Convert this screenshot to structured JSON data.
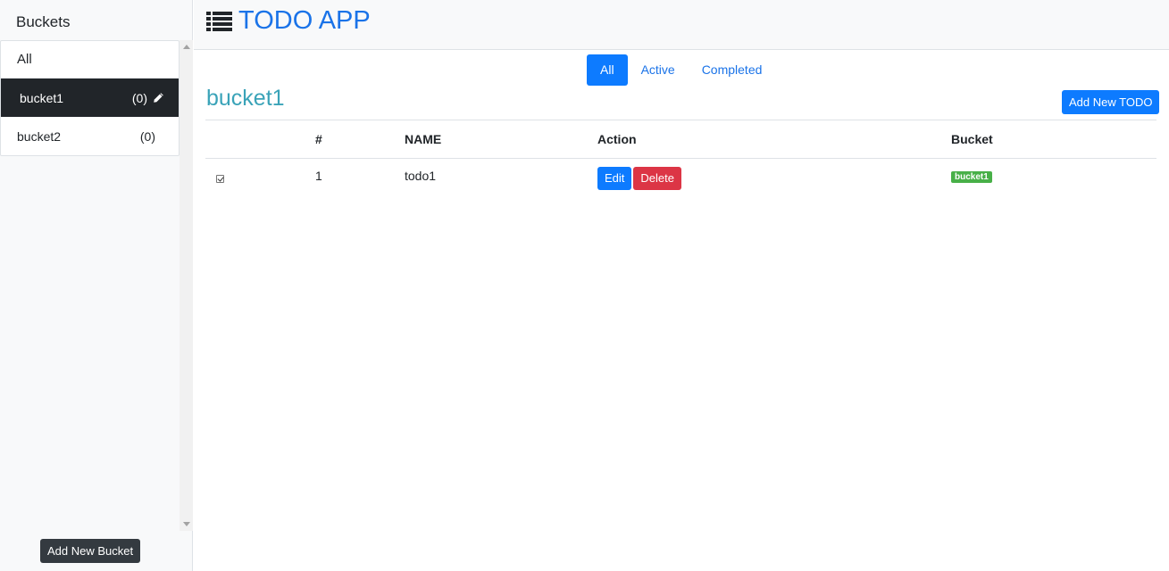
{
  "sidebar": {
    "title": "Buckets",
    "all_label": "All",
    "buckets": [
      {
        "name": "bucket1",
        "count": "(0)",
        "active": true
      },
      {
        "name": "bucket2",
        "count": "(0)",
        "active": false
      }
    ],
    "add_button": "Add New Bucket"
  },
  "header": {
    "app_title": "TODO APP",
    "icon": "list-icon"
  },
  "filters": [
    "All",
    "Active",
    "Completed"
  ],
  "active_filter": "All",
  "main": {
    "bucket_heading": "bucket1",
    "add_todo_button": "Add New TODO",
    "columns": [
      "",
      "#",
      "NAME",
      "Action",
      "Bucket"
    ],
    "rows": [
      {
        "checked": true,
        "num": "1",
        "name": "todo1",
        "edit": "Edit",
        "delete": "Delete",
        "bucket": "bucket1"
      }
    ]
  },
  "colors": {
    "accent": "#0d7bff",
    "title": "#1a73e8",
    "heading": "#3aa3b8",
    "danger": "#dc3545",
    "badge": "#48b048",
    "active_bucket_bg": "#212529"
  }
}
